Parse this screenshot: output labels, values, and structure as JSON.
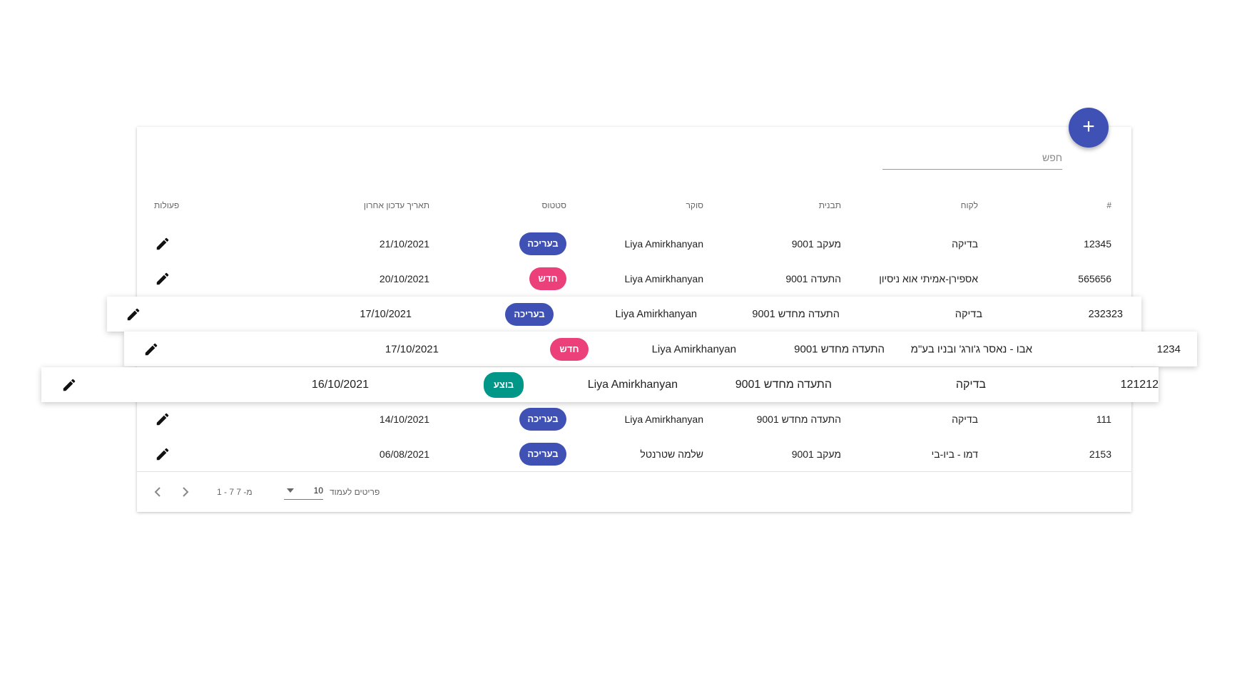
{
  "search": {
    "placeholder": "חפש"
  },
  "add_button": {
    "label": "+"
  },
  "headers": {
    "id": "#",
    "customer": "לקוח",
    "template": "תבנית",
    "surveyor": "סוקר",
    "status": "סטטוס",
    "last_update": "תאריך עדכון אחרון",
    "actions": "פעולות"
  },
  "rows": [
    {
      "id": "12345",
      "customer": "בדיקה",
      "template": "9001 מעקב",
      "surveyor": "Liya Amirkhanyan",
      "status": "בעריכה",
      "date": "21/10/2021"
    },
    {
      "id": "565656",
      "customer": "אספירן-אמיתי אוא ניסיון",
      "template": "9001 התעדה",
      "surveyor": "Liya Amirkhanyan",
      "status": "חדש",
      "date": "20/10/2021"
    },
    {
      "id": "232323",
      "customer": "בדיקה",
      "template": "9001 התעדה מחדש",
      "surveyor": "Liya Amirkhanyan",
      "status": "בעריכה",
      "date": "17/10/2021"
    },
    {
      "id": "1234",
      "customer": "אבו - נאסר ג'ורג' ובניו בע\"מ",
      "template": "9001 התעדה מחדש",
      "surveyor": "Liya Amirkhanyan",
      "status": "חדש",
      "date": "17/10/2021"
    },
    {
      "id": "121212",
      "customer": "בדיקה",
      "template": "9001 התעדה מחדש",
      "surveyor": "Liya Amirkhanyan",
      "status": "בוצע",
      "date": "16/10/2021"
    },
    {
      "id": "111",
      "customer": "בדיקה",
      "template": "9001 התעדה מחדש",
      "surveyor": "Liya Amirkhanyan",
      "status": "בעריכה",
      "date": "14/10/2021"
    },
    {
      "id": "2153",
      "customer": "דמו - ביו-בי",
      "template": "9001 מעקב",
      "surveyor": "שלמה שטרנטל",
      "status": "בעריכה",
      "date": "06/08/2021"
    }
  ],
  "footer": {
    "per_page_label": "פריטים לעמוד",
    "per_page_value": "10",
    "range": "1 - 7 מ- 7"
  },
  "colors": {
    "primary": "#3f51b5",
    "status_editing": "#3f51b5",
    "status_new": "#ec407a",
    "status_done": "#009688"
  }
}
